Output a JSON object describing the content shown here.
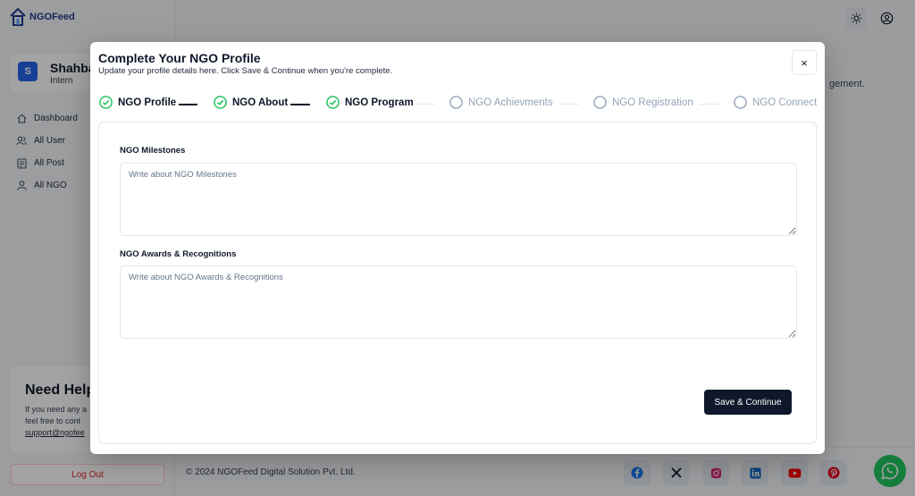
{
  "brand": {
    "name": "NGOFeed"
  },
  "user": {
    "initial": "S",
    "name": "Shahba",
    "role": "Intern"
  },
  "sidebar": {
    "items": [
      {
        "label": "Dashboard",
        "icon": "home-icon"
      },
      {
        "label": "All User",
        "icon": "users-icon"
      },
      {
        "label": "All Post",
        "icon": "post-icon"
      },
      {
        "label": "All NGO",
        "icon": "ngo-icon"
      }
    ],
    "help": {
      "title": "Need Help",
      "line1": "If you need any a",
      "line2": "feel free to cont",
      "link": "support@ngofee"
    },
    "logout": "Log Out"
  },
  "background": {
    "text": "gement."
  },
  "footer": {
    "copyright": "© 2024 NGOFeed Digital Solution Pvt. Ltd.",
    "socials": [
      "facebook-icon",
      "x-icon",
      "instagram-icon",
      "linkedin-icon",
      "youtube-icon",
      "pinterest-icon"
    ]
  },
  "modal": {
    "title": "Complete Your NGO Profile",
    "subtitle": "Update your profile details here. Click Save & Continue when you're complete.",
    "close": "×",
    "steps": [
      {
        "label": "NGO Profile",
        "status": "done"
      },
      {
        "label": "NGO About",
        "status": "done"
      },
      {
        "label": "NGO Program",
        "status": "done"
      },
      {
        "label": "NGO Achievments",
        "status": "todo"
      },
      {
        "label": "NGO Registration",
        "status": "todo"
      },
      {
        "label": "NGO Connect",
        "status": "todo"
      }
    ],
    "fields": [
      {
        "label": "NGO Milestones",
        "placeholder": "Write about NGO Milestones",
        "value": ""
      },
      {
        "label": "NGO Awards & Recognitions",
        "placeholder": "Write about NGO Awards & Recognitions",
        "value": ""
      }
    ],
    "save_label": "Save & Continue"
  },
  "colors": {
    "accent": "#0f172a",
    "done_check": "#22c55e",
    "todo": "#94a3b8",
    "logout": "#dc2626",
    "whatsapp": "#22c55e"
  }
}
